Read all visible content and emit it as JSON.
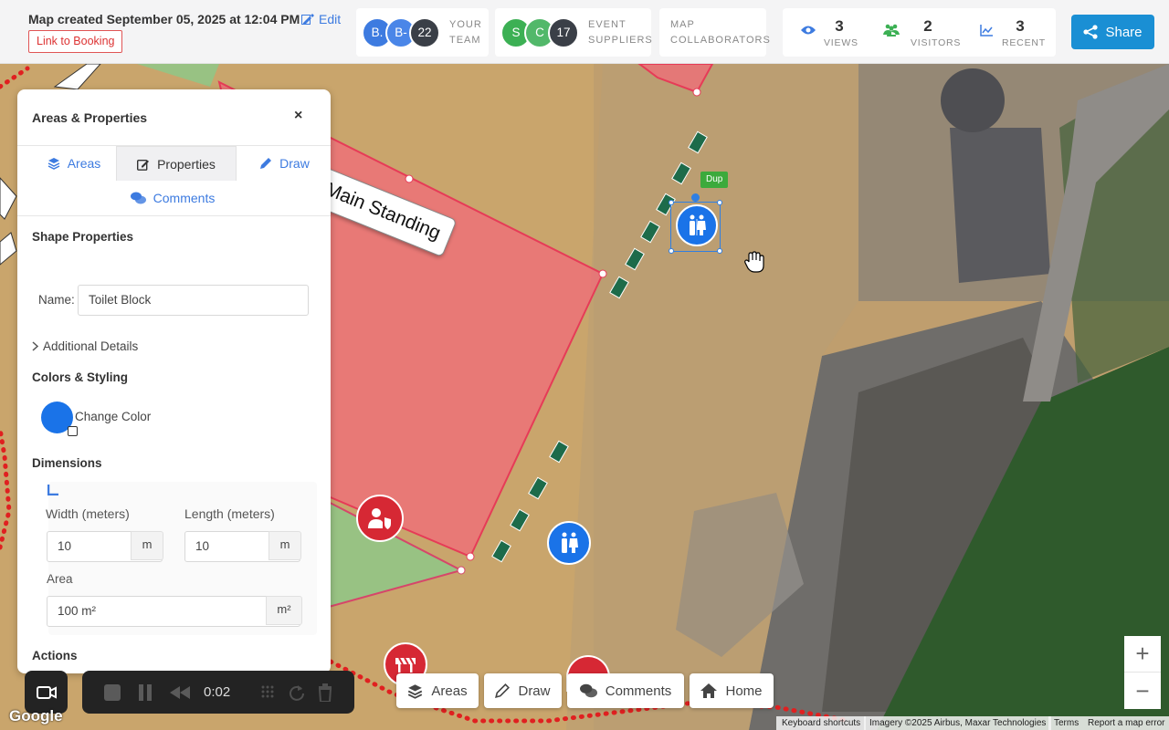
{
  "header": {
    "map_title": "Map created September 05, 2025 at 12:04 PM",
    "edit_label": "Edit",
    "booking_label": "Link to Booking",
    "team": {
      "avatars": [
        "B.",
        "B-",
        "22"
      ],
      "label_line1": "YOUR",
      "label_line2": "TEAM"
    },
    "suppliers": {
      "avatars": [
        "S",
        "C",
        "17"
      ],
      "label_line1": "EVENT",
      "label_line2": "SUPPLIERS"
    },
    "collaborators": {
      "label_line1": "MAP",
      "label_line2": "COLLABORATORS"
    },
    "stats": [
      {
        "value": "3",
        "label": "VIEWS",
        "icon": "eye-icon"
      },
      {
        "value": "2",
        "label": "VISITORS",
        "icon": "users-icon"
      },
      {
        "value": "3",
        "label": "RECENT",
        "icon": "chart-line-icon"
      }
    ],
    "share_label": "Share"
  },
  "panel": {
    "title": "Areas & Properties",
    "close": "×",
    "tabs": [
      {
        "label": "Areas",
        "icon": "layers-icon"
      },
      {
        "label": "Properties",
        "icon": "edit-icon"
      },
      {
        "label": "Draw",
        "icon": "pencil-icon"
      },
      {
        "label": "Comments",
        "icon": "comments-icon"
      }
    ],
    "shape_properties": "Shape Properties",
    "name_label": "Name:",
    "name_value": "Toilet Block",
    "additional_details": "Additional Details",
    "colors_styling": "Colors & Styling",
    "color": "#1a73e8",
    "change_color": "Change Color",
    "dimensions": "Dimensions",
    "width_label": "Width (meters)",
    "width_value": "10",
    "width_unit": "m",
    "length_label": "Length (meters)",
    "length_value": "10",
    "length_unit": "m",
    "area_label": "Area",
    "area_value": "100 m²",
    "area_unit": "m²",
    "actions": "Actions"
  },
  "map": {
    "main_label": "Main Standing",
    "dup_badge": "Dup"
  },
  "recorder": {
    "time": "0:02"
  },
  "bottom_nav": [
    {
      "label": "Areas",
      "icon": "layers-icon"
    },
    {
      "label": "Draw",
      "icon": "pencil-icon"
    },
    {
      "label": "Comments",
      "icon": "comments-icon"
    },
    {
      "label": "Home",
      "icon": "home-icon"
    }
  ],
  "zoom": {
    "in": "+",
    "out": "−"
  },
  "attribution": {
    "google": "Google",
    "shortcuts": "Keyboard shortcuts",
    "imagery": "Imagery ©2025 Airbus, Maxar Technologies",
    "terms": "Terms",
    "report": "Report a map error"
  },
  "colors": {
    "accent": "#1a8fd4",
    "link": "#3d7be0",
    "zone_red": "#f26b7a",
    "zone_green": "#8cc98a"
  }
}
